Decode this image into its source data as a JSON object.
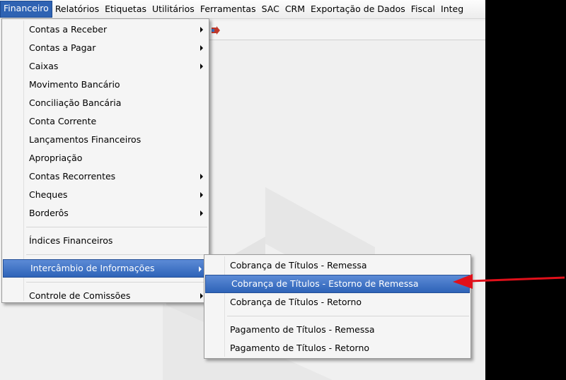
{
  "menubar": {
    "items": [
      "Financeiro",
      "Relatórios",
      "Etiquetas",
      "Utilitários",
      "Ferramentas",
      "SAC",
      "CRM",
      "Exportação de Dados",
      "Fiscal",
      "Integ"
    ]
  },
  "financeiro_menu": {
    "items": [
      {
        "label": "Contas a Receber",
        "submenu": true
      },
      {
        "label": "Contas a Pagar",
        "submenu": true
      },
      {
        "label": "Caixas",
        "submenu": true
      },
      {
        "label": "Movimento Bancário",
        "submenu": false
      },
      {
        "label": "Conciliação Bancária",
        "submenu": false
      },
      {
        "label": "Conta Corrente",
        "submenu": false
      },
      {
        "label": "Lançamentos Financeiros",
        "submenu": false
      },
      {
        "label": "Apropriação",
        "submenu": false
      },
      {
        "label": "Contas Recorrentes",
        "submenu": true
      },
      {
        "label": "Cheques",
        "submenu": true
      },
      {
        "label": "Borderôs",
        "submenu": true
      },
      {
        "label": "Índices Financeiros",
        "submenu": false
      },
      {
        "label": "Intercâmbio de Informações",
        "submenu": true
      },
      {
        "label": "Controle de Comissões",
        "submenu": true
      }
    ]
  },
  "intercambio_submenu": {
    "items": [
      {
        "label": "Cobrança de Títulos - Remessa"
      },
      {
        "label": "Cobrança de Títulos - Estorno de Remessa"
      },
      {
        "label": "Cobrança de Títulos - Retorno"
      },
      {
        "label": "Pagamento de Títulos - Remessa"
      },
      {
        "label": "Pagamento de Títulos - Retorno"
      }
    ]
  },
  "colors": {
    "highlight": "#2e63b8",
    "pointer_arrow": "#e0101a"
  }
}
